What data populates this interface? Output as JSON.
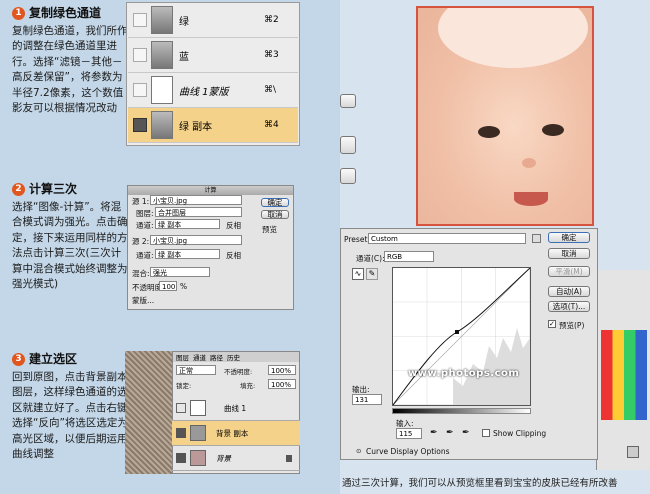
{
  "step1": {
    "num": "1",
    "title": "复制绿色通道",
    "body": "复制绿色通道，我们所作的调整在绿色通道里进行。选择“滤镜－其他－高反差保留”，将参数为半径7.2像素，这个数值影友可以根据情况改动"
  },
  "step2": {
    "num": "2",
    "title": "计算三次",
    "body": "选择“图像-计算”。将混合模式调为强光。点击确定，接下来运用同样的方法点击计算三次(三次计算中混合模式始终调整为强光模式)"
  },
  "step3": {
    "num": "3",
    "title": "建立选区",
    "body": "回到原图，点击背景副本图层，这样绿色通道的选区就建立好了。点击右键选择“反向”将选区选定为高光区域，以便后期运用曲线调整"
  },
  "channels": [
    {
      "name": "绿",
      "shortcut": "⌘2"
    },
    {
      "name": "蓝",
      "shortcut": "⌘3"
    },
    {
      "name": "曲线 1蒙版",
      "shortcut": "⌘\\"
    },
    {
      "name": "绿 副本",
      "shortcut": "⌘4"
    }
  ],
  "calc": {
    "title": "计算",
    "src1": "源 1:",
    "src1_val": "小宝贝.jpg",
    "layer": "图层:",
    "layer_val": "合并图层",
    "channel": "通道:",
    "ch1_val": "绿 副本",
    "src2": "源 2:",
    "src2_val": "小宝贝.jpg",
    "ch2_val": "绿 副本",
    "invert": "反相",
    "blend": "混合:",
    "blend_val": "强光",
    "opacity": "不透明度:",
    "opacity_val": "100",
    "pct": "%",
    "mask": "蒙版...",
    "ok": "确定",
    "cancel": "取消",
    "preview": "预览"
  },
  "layers": {
    "tabs": [
      "图层",
      "通道",
      "路径",
      "历史"
    ],
    "mode": "正常",
    "opacity_lbl": "不透明度:",
    "opacity_val": "100%",
    "lock": "锁定:",
    "fill_lbl": "填充:",
    "fill_val": "100%",
    "items": [
      {
        "name": "曲线 1"
      },
      {
        "name": "背景 副本"
      },
      {
        "name": "背景"
      }
    ]
  },
  "curves": {
    "preset_lbl": "Preset:",
    "preset_val": "Custom",
    "channel_lbl": "通道(C):",
    "channel_val": "RGB",
    "output_lbl": "输出:",
    "output_val": "131",
    "input_lbl": "输入:",
    "input_val": "115",
    "show_clip": "Show Clipping",
    "display_opts": "Curve Display Options",
    "ok": "确定",
    "cancel": "取消",
    "smooth": "平滑(M)",
    "auto": "自动(A)",
    "options": "选项(T)...",
    "preview": "预览(P)"
  },
  "watermark": "www.photops.com",
  "caption": "通过三次计算，我们可以从预览框里看到宝宝的皮肤已经有所改善"
}
